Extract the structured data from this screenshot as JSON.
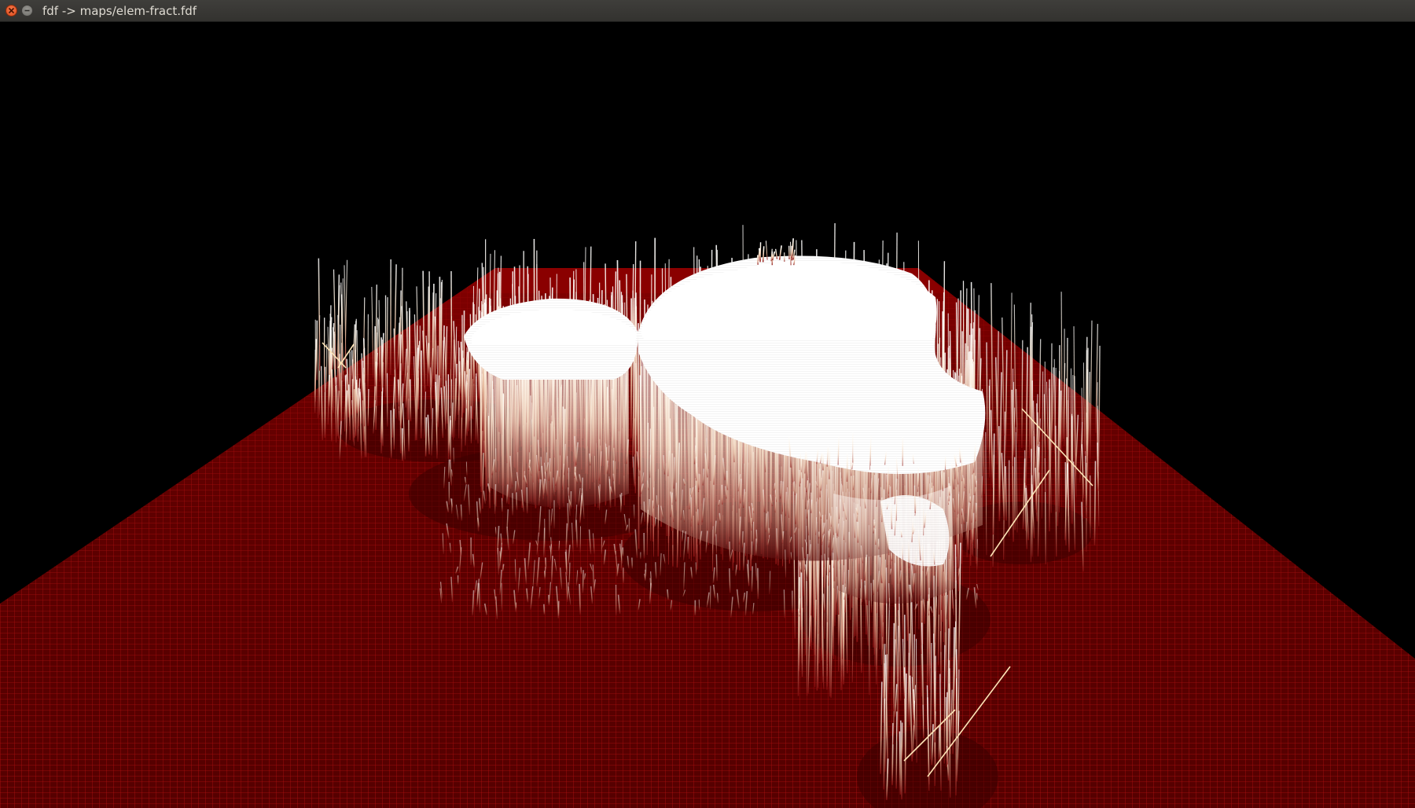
{
  "window": {
    "title": "fdf -> maps/elem-fract.fdf",
    "controls": {
      "close_icon": "close-icon",
      "minimize_icon": "minimize-icon"
    }
  },
  "render": {
    "description_icon": "wireframe-render",
    "colors": {
      "background": "#000000",
      "base_plane": "#7a0000",
      "grid_line": "#c01010",
      "peak": "#ffffff",
      "mid": "#f0c8a0"
    }
  }
}
